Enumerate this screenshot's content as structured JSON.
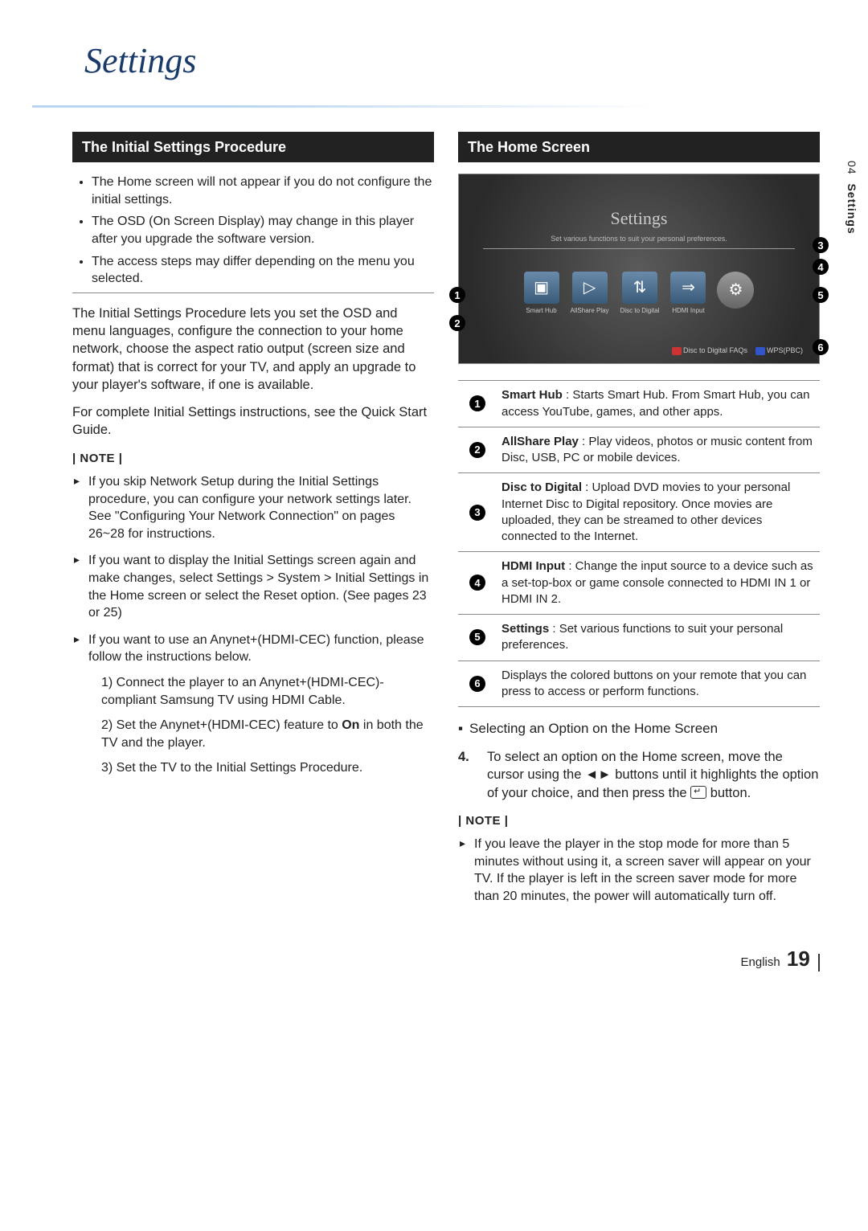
{
  "title": "Settings",
  "side_tab": {
    "chapter": "04",
    "label": "Settings"
  },
  "left": {
    "header": "The Initial Settings Procedure",
    "bullets": [
      "The Home screen will not appear if you do not configure the initial settings.",
      "The OSD (On Screen Display) may change in this player after you upgrade the software version.",
      "The access steps may differ depending on the menu you selected."
    ],
    "para1": "The Initial Settings Procedure lets you set the OSD and menu languages, configure the connection to your home network, choose the aspect ratio output (screen size and format) that is correct for your TV, and apply an upgrade to your player's software, if one is available.",
    "para2": "For complete Initial Settings instructions, see the Quick Start Guide.",
    "note_label": "| NOTE |",
    "notes": [
      "If you skip Network Setup during the Initial Settings procedure, you can configure your network settings later. See \"Configuring Your Network Connection\" on pages 26~28 for instructions.",
      "If you want to display the Initial Settings screen again and make changes, select Settings > System > Initial Settings in the Home screen or select the Reset option. (See pages 23 or 25)",
      "If you want to use an Anynet+(HDMI-CEC) function, please follow the instructions below."
    ],
    "subnotes": [
      "1)  Connect the player to an Anynet+(HDMI-CEC)-compliant Samsung TV using HDMI Cable.",
      "2)  Set the Anynet+(HDMI-CEC) feature to On in both the TV and the player.",
      "3)  Set the TV to the Initial Settings Procedure."
    ],
    "on_word": "On"
  },
  "right": {
    "header": "The Home Screen",
    "screenshot": {
      "title": "Settings",
      "subtitle": "Set various functions to suit your personal preferences.",
      "icons": [
        {
          "label": "Smart Hub",
          "glyph": "▣"
        },
        {
          "label": "AllShare Play",
          "glyph": "▷"
        },
        {
          "label": "Disc to Digital",
          "glyph": "⇅"
        },
        {
          "label": "HDMI Input",
          "glyph": "⇒"
        },
        {
          "label": "",
          "glyph": "⚙"
        }
      ],
      "footer_left": "Disc to Digital FAQs",
      "footer_right": "WPS(PBC)"
    },
    "table": [
      {
        "n": "1",
        "bold": "Smart Hub",
        "text": " : Starts Smart Hub. From Smart Hub, you can access YouTube, games, and other apps."
      },
      {
        "n": "2",
        "bold": "AllShare Play",
        "text": " : Play videos, photos or music content from Disc, USB, PC or mobile devices."
      },
      {
        "n": "3",
        "bold": "Disc to Digital",
        "text": " : Upload DVD movies to your personal Internet Disc to Digital repository. Once movies are uploaded, they can be streamed to other devices connected to the Internet."
      },
      {
        "n": "4",
        "bold": "HDMI Input",
        "text": " : Change the input source to a device such as a set-top-box or game console connected to HDMI IN 1 or HDMI IN 2."
      },
      {
        "n": "5",
        "bold": "Settings",
        "text": " : Set various functions to suit your personal preferences."
      },
      {
        "n": "6",
        "bold": "",
        "text": "Displays the colored buttons on your remote that you can press to access or perform functions."
      }
    ],
    "select_heading": "Selecting an Option on the Home Screen",
    "step_num": "4.",
    "step_text_a": "To select an option on the Home screen, move the cursor using the ◄► buttons until it highlights the option of your choice, and then press the ",
    "step_text_b": " button.",
    "note_label": "| NOTE |",
    "note": "If you leave the player in the stop mode for more than 5 minutes without using it, a screen saver will appear on your TV. If the player is left in the screen saver mode for more than 20 minutes, the power will automatically turn off."
  },
  "footer": {
    "lang": "English",
    "page": "19"
  }
}
